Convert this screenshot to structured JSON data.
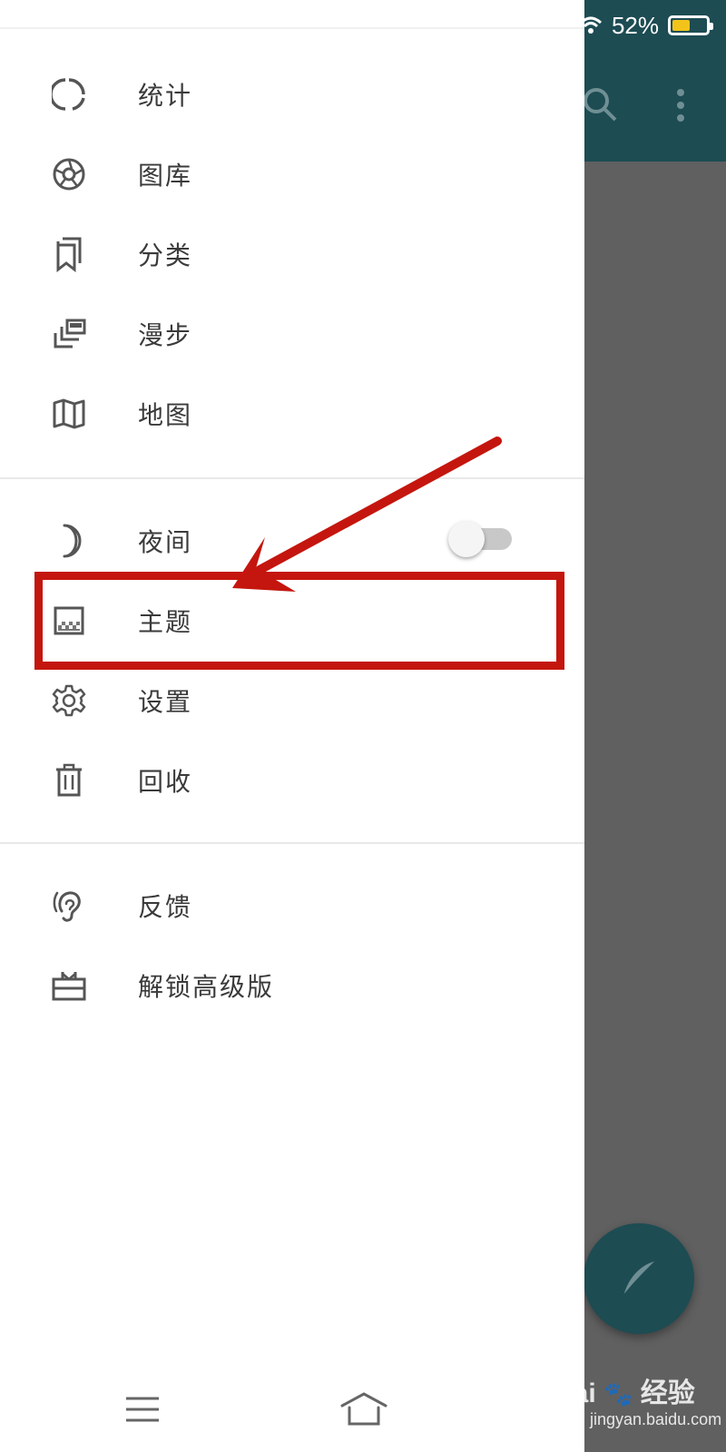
{
  "status_bar": {
    "battery_text": "52%",
    "battery_level": 0.52
  },
  "drawer": {
    "section1": [
      {
        "id": "stats",
        "label": "统计",
        "icon": "ring-chart-icon"
      },
      {
        "id": "gallery",
        "label": "图库",
        "icon": "aperture-icon"
      },
      {
        "id": "category",
        "label": "分类",
        "icon": "bookmark-icon"
      },
      {
        "id": "walk",
        "label": "漫步",
        "icon": "stacked-cards-icon"
      },
      {
        "id": "map",
        "label": "地图",
        "icon": "map-icon"
      }
    ],
    "section2": [
      {
        "id": "night",
        "label": "夜间",
        "icon": "moon-icon",
        "toggle": false
      },
      {
        "id": "theme",
        "label": "主题",
        "icon": "theme-icon"
      },
      {
        "id": "settings",
        "label": "设置",
        "icon": "gear-icon"
      },
      {
        "id": "trash",
        "label": "回收",
        "icon": "trash-icon"
      }
    ],
    "section3": [
      {
        "id": "feedback",
        "label": "反馈",
        "icon": "ear-icon"
      },
      {
        "id": "premium",
        "label": "解锁高级版",
        "icon": "gift-box-icon"
      }
    ]
  },
  "watermark": {
    "brand": "Bai",
    "brand_cn": "经验",
    "url": "jingyan.baidu.com"
  },
  "colors": {
    "accent": "#1d4c53",
    "annotation": "#c4160e",
    "scrim": "#606060"
  }
}
